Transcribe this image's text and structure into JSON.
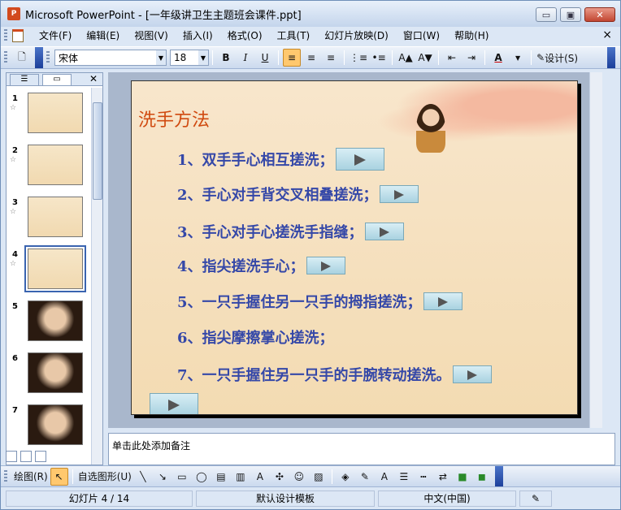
{
  "window": {
    "title": "Microsoft PowerPoint - [一年级讲卫生主题班会课件.ppt]",
    "minimize_label": "▭",
    "restore_label": "▣",
    "close_label": "✕"
  },
  "menubar": {
    "items": [
      "文件(F)",
      "编辑(E)",
      "视图(V)",
      "插入(I)",
      "格式(O)",
      "工具(T)",
      "幻灯片放映(D)",
      "窗口(W)",
      "帮助(H)"
    ],
    "close_label": "×"
  },
  "toolbar": {
    "font_name": "宋体",
    "font_size": "18",
    "bold": "B",
    "italic": "I",
    "underline": "U",
    "design_label": "设计(S)"
  },
  "slide_panel": {
    "thumbnails": [
      {
        "num": "1",
        "type": "title"
      },
      {
        "num": "2",
        "type": "text"
      },
      {
        "num": "3",
        "type": "text"
      },
      {
        "num": "4",
        "type": "text",
        "current": true
      },
      {
        "num": "5",
        "type": "photo"
      },
      {
        "num": "6",
        "type": "photo"
      },
      {
        "num": "7",
        "type": "photo"
      }
    ]
  },
  "slide": {
    "title": "洗手方法",
    "items": [
      "1、双手手心相互搓洗；",
      "2、手心对手背交叉相叠搓洗；",
      "3、手心对手心搓洗手指缝；",
      "4、指尖搓洗手心；",
      "5、一只手握住另一只手的拇指搓洗；",
      "6、指尖摩擦掌心搓洗；",
      "7、一只手握住另一只手的手腕转动搓洗。"
    ]
  },
  "notes": {
    "placeholder": "单击此处添加备注"
  },
  "drawbar": {
    "draw_label": "绘图(R)",
    "autoshape_label": "自选图形(U)"
  },
  "statusbar": {
    "slide_info": "幻灯片 4 / 14",
    "template": "默认设计模板",
    "language": "中文(中国)"
  }
}
